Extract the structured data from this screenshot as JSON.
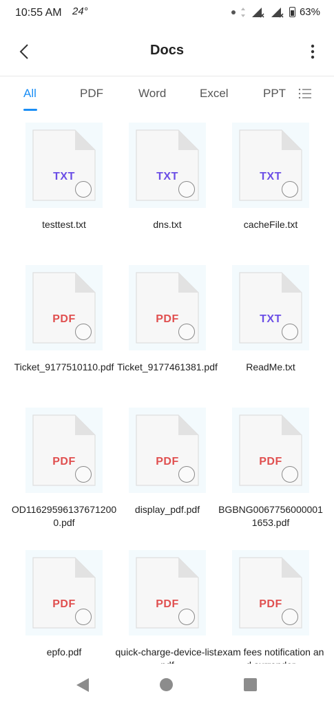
{
  "status_bar": {
    "time": "10:55 AM",
    "temperature": "24°",
    "battery": "63%"
  },
  "header": {
    "title": "Docs"
  },
  "tabs": [
    {
      "label": "All",
      "active": true
    },
    {
      "label": "PDF",
      "active": false
    },
    {
      "label": "Word",
      "active": false
    },
    {
      "label": "Excel",
      "active": false
    },
    {
      "label": "PPT",
      "active": false
    }
  ],
  "colors": {
    "accent": "#1a8ef5",
    "txt_label": "#6b4ee6",
    "pdf_label": "#e04f4f"
  },
  "files": [
    {
      "type": "TXT",
      "name": "testtest.txt"
    },
    {
      "type": "TXT",
      "name": "dns.txt"
    },
    {
      "type": "TXT",
      "name": "cacheFile.txt"
    },
    {
      "type": "PDF",
      "name": "Ticket_9177510110.pdf"
    },
    {
      "type": "PDF",
      "name": "Ticket_9177461381.pdf"
    },
    {
      "type": "TXT",
      "name": "ReadMe.txt"
    },
    {
      "type": "PDF",
      "name": "OD116295961376712000.pdf"
    },
    {
      "type": "PDF",
      "name": "display_pdf.pdf"
    },
    {
      "type": "PDF",
      "name": "BGBNG00677560000011653.pdf"
    },
    {
      "type": "PDF",
      "name": "epfo.pdf"
    },
    {
      "type": "PDF",
      "name": "quick-charge-device-list.pdf"
    },
    {
      "type": "PDF",
      "name": "exam fees notification and surrender"
    }
  ]
}
